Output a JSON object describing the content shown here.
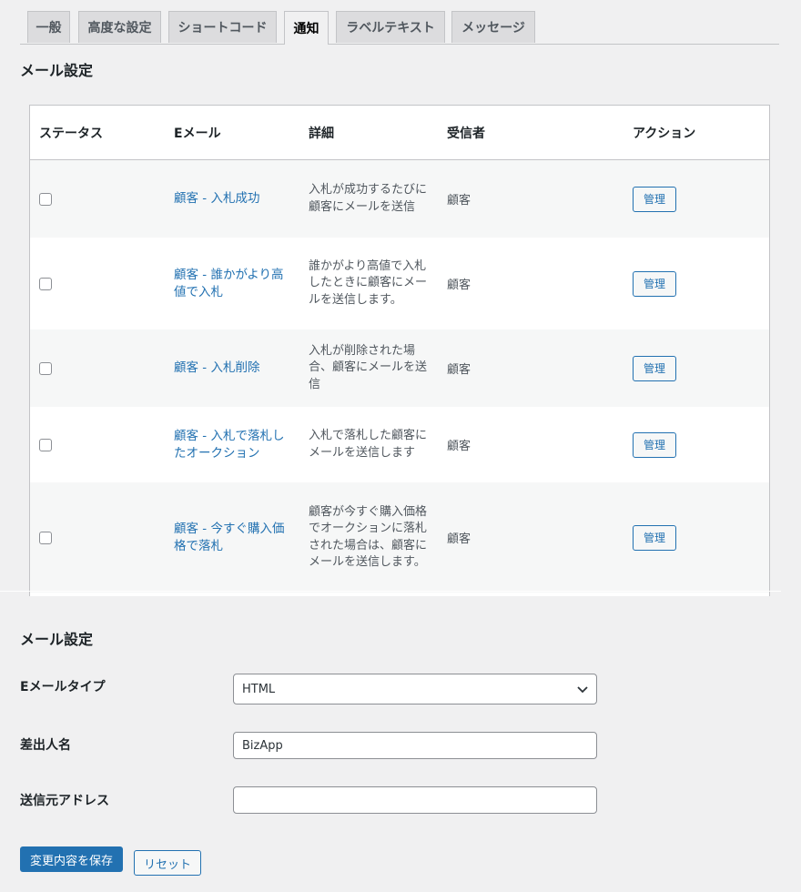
{
  "tabs": [
    {
      "label": "一般"
    },
    {
      "label": "高度な設定"
    },
    {
      "label": "ショートコード"
    },
    {
      "label": "通知"
    },
    {
      "label": "ラベルテキスト"
    },
    {
      "label": "メッセージ"
    }
  ],
  "active_tab": "通知",
  "section1_title": "メール設定",
  "table": {
    "headers": [
      "ステータス",
      "Eメール",
      "詳細",
      "受信者",
      "アクション"
    ],
    "rows": [
      {
        "email": "顧客 - 入札成功",
        "desc": "入札が成功するたびに顧客にメールを送信",
        "recipient": "顧客",
        "action": "管理"
      },
      {
        "email": "顧客 - 誰かがより高値で入札",
        "desc": "誰かがより高値で入札したときに顧客にメールを送信します。",
        "recipient": "顧客",
        "action": "管理"
      },
      {
        "email": "顧客 - 入札削除",
        "desc": "入札が削除された場合、顧客にメールを送信",
        "recipient": "顧客",
        "action": "管理"
      },
      {
        "email": "顧客 - 入札で落札したオークション",
        "desc": "入札で落札した顧客にメールを送信します",
        "recipient": "顧客",
        "action": "管理"
      },
      {
        "email": "顧客 - 今すぐ購入価格で落札",
        "desc": "顧客が今すぐ購入価格でオークションに落札された場合は、顧客にメールを送信します。",
        "recipient": "顧客",
        "action": "管理"
      }
    ]
  },
  "section2_title": "メール設定",
  "form": {
    "email_type_label": "Eメールタイプ",
    "email_type_value": "HTML",
    "sender_name_label": "差出人名",
    "sender_name_value": "BizApp",
    "sender_address_label": "送信元アドレス",
    "sender_address_value": ""
  },
  "buttons": {
    "save": "変更内容を保存",
    "reset": "リセット"
  },
  "colors": {
    "accent": "#2271b1",
    "background": "#f0f0f1"
  }
}
